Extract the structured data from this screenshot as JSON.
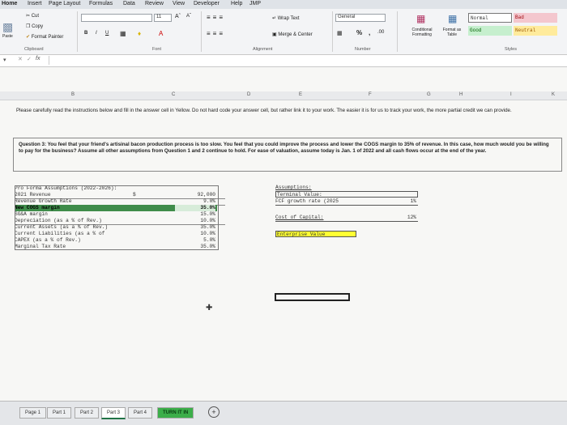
{
  "menu": [
    "Home",
    "Insert",
    "Page Layout",
    "Formulas",
    "Data",
    "Review",
    "View",
    "Developer",
    "Help",
    "JMP"
  ],
  "ribbon": {
    "clipboard": {
      "cut": "Cut",
      "copy": "Copy",
      "paste": "Paste",
      "format_painter": "Format Painter",
      "label": "Clipboard"
    },
    "font": {
      "size": "11",
      "bold": "B",
      "italic": "I",
      "underline": "U",
      "label": "Font"
    },
    "alignment": {
      "wrap": "Wrap Text",
      "merge": "Merge & Center",
      "label": "Alignment"
    },
    "number": {
      "format": "General",
      "percent": "%",
      "comma": ",",
      "label": "Number"
    },
    "styles": {
      "conditional": "Conditional Formatting",
      "format_table": "Format as Table",
      "normal": "Normal",
      "bad": "Bad",
      "good": "Good",
      "neutral": "Neutral",
      "label": "Styles"
    }
  },
  "formula_bar": {
    "fx": "fx"
  },
  "columns": [
    "B",
    "C",
    "D",
    "E",
    "F",
    "G",
    "H",
    "I",
    "K"
  ],
  "instructions": "Please carefully read the instructions below and fill in the answer cell in Yellow. Do not hard code your answer cell, but rather link it to your work. The easier it is for us to track your work, the more partial credit we can provide.",
  "question": "Question 3: You feel that your friend's artisinal bacon production process is too slow. You feel that you could improve the process and lower the COGS margin to 35% of revenue. In this case, how much would you be willing to pay for the business? Assume all other assumptions from Question 1 and 2 continue to hold. For ease of valuation, assume today is Jan. 1 of 2022 and all cash flows occur at the end of the year.",
  "assumptions": {
    "title": "Pro Forma Assumptions (2022-2026):",
    "rows": [
      {
        "label": "2021 Revenue",
        "currency": "$",
        "value": "92,000"
      },
      {
        "label": "Revenue Growth Rate",
        "currency": "",
        "value": "9.0%"
      },
      {
        "label": "New COGS margin",
        "currency": "",
        "value": "35.0%"
      },
      {
        "label": "SG&A margin",
        "currency": "",
        "value": "15.0%"
      },
      {
        "label": "Depreciation (as a % of Rev.)",
        "currency": "",
        "value": "10.0%"
      },
      {
        "label": "Current Assets (as a % of Rev.)",
        "currency": "",
        "value": "35.0%"
      },
      {
        "label": "Current Liabilities (as a % of",
        "currency": "",
        "value": "10.0%"
      },
      {
        "label": "CAPEX (as a % of Rev.)",
        "currency": "",
        "value": "5.0%"
      },
      {
        "label": "Marginal Tax Rate",
        "currency": "",
        "value": "35.0%"
      }
    ]
  },
  "right_panel": {
    "title": "Assumptions:",
    "terminal": "Terminal Value:",
    "growth_label": "FCF growth rate (2025",
    "growth_value": "1%",
    "cost_label": "Cost of Capital:",
    "cost_value": "12%",
    "ev_label": "Enterprise Value"
  },
  "sheet_tabs": [
    "Page 1",
    "Part 1",
    "Part 2",
    "Part 3",
    "Part 4",
    "TURN IT IN"
  ],
  "add_sheet": "+"
}
